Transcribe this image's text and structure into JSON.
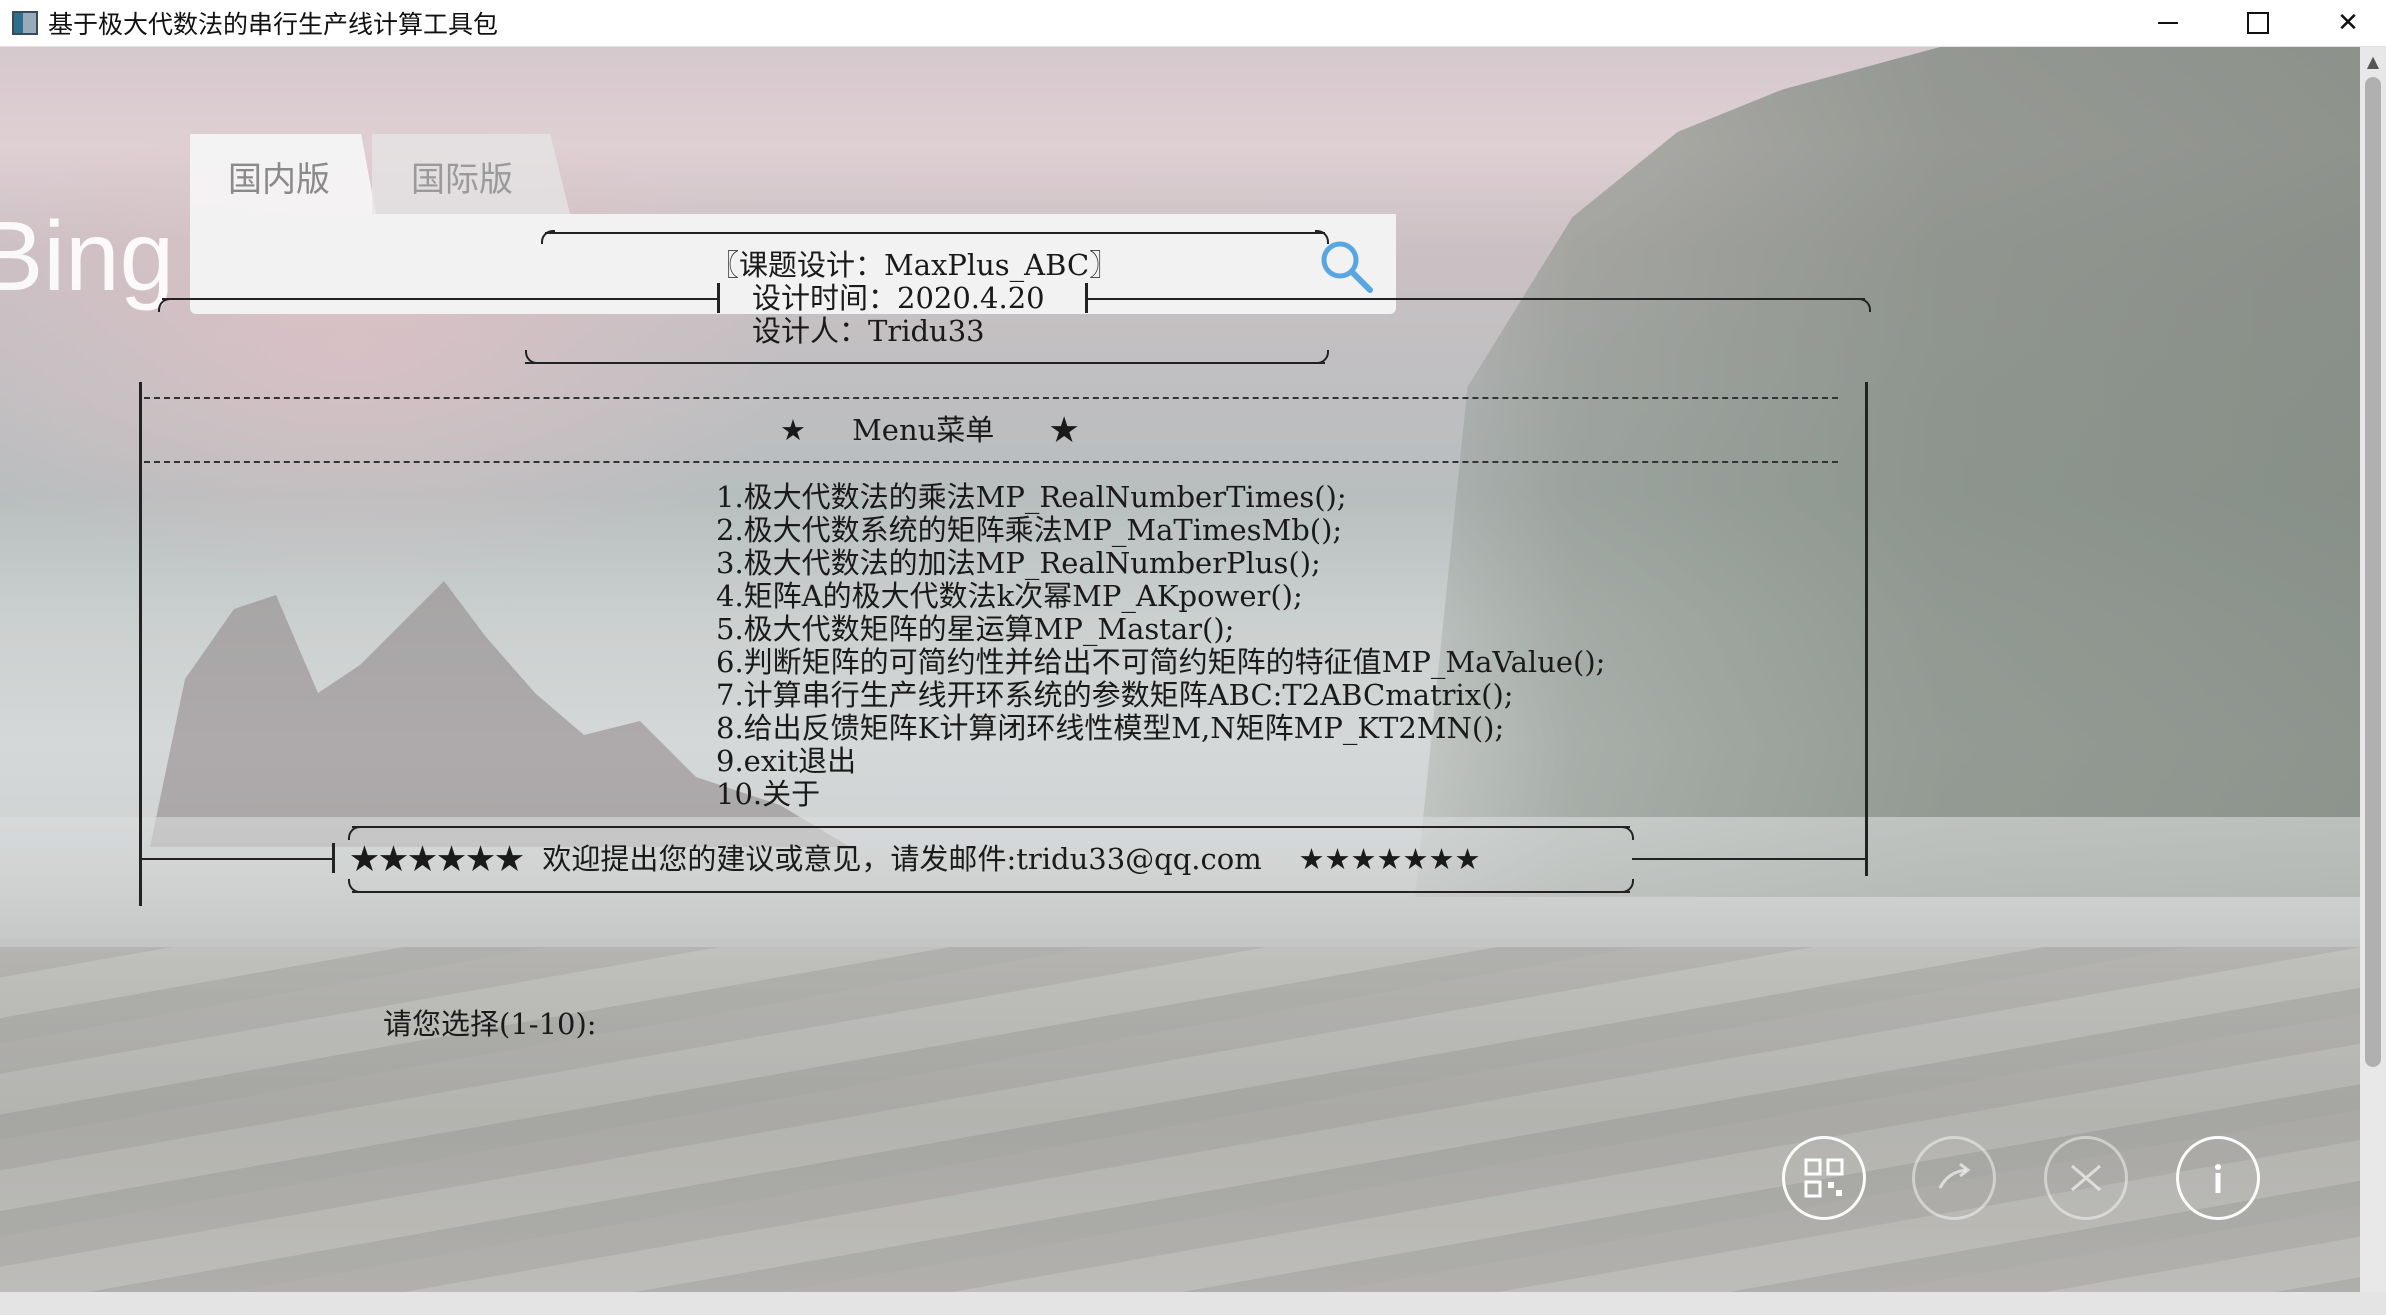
{
  "window": {
    "title": "基于极大代数法的串行生产线计算工具包",
    "controls": {
      "minimize": "minimize",
      "maximize": "maximize",
      "close": "✕"
    }
  },
  "background": {
    "logo": "Bing",
    "tabs": [
      "国内版",
      "国际版"
    ]
  },
  "console": {
    "header": {
      "title": "〖课题设计：MaxPlus_ABC〗",
      "time": "设计时间：2020.4.20",
      "author": "设计人：Tridu33"
    },
    "menu_title": "★     Menu菜单      ★",
    "menu_items": [
      "1.极大代数法的乘法MP_RealNumberTimes();",
      "2.极大代数系统的矩阵乘法MP_MaTimesMb();",
      "3.极大代数法的加法MP_RealNumberPlus();",
      "4.矩阵A的极大代数法k次幂MP_AKpower();",
      "5.极大代数矩阵的星运算MP_Mastar();",
      "6.判断矩阵的可简约性并给出不可简约矩阵的特征值MP_MaValue();",
      "7.计算串行生产线开环系统的参数矩阵ABC:T2ABCmatrix();",
      "8.给出反馈矩阵K计算闭环线性模型M,N矩阵MP_KT2MN();",
      "9.exit退出",
      "10.关于"
    ],
    "footer_text": "★★★★★★  欢迎提出您的建议或意见，请发邮件:tridu33@qq.com    ★★★★★★★",
    "prompt": "请您选择(1-10):"
  },
  "overlay_buttons": [
    "qr-code-icon",
    "share-icon",
    "shuffle-icon",
    "info-icon"
  ],
  "colors": {
    "titlebar": "#ffffff",
    "text": "#1a1a1a",
    "panel": "#f5f5f5"
  }
}
